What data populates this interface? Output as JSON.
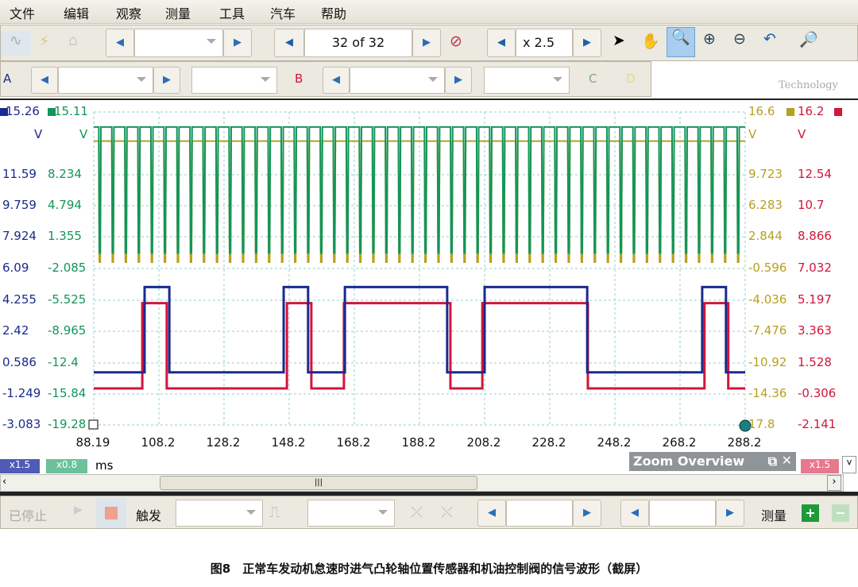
{
  "menu": [
    "文件",
    "编辑",
    "观察",
    "测量",
    "工具",
    "汽车",
    "帮助"
  ],
  "toolbar": {
    "buffer_value": "32 of 32",
    "zoom_value": "x 2.5",
    "watermark": "Technology"
  },
  "channels": {
    "a": "A",
    "b": "B",
    "c": "C",
    "d": "D"
  },
  "colors": {
    "a": "#1b2a8c",
    "b": "#13955a",
    "c": "#b7a020",
    "d": "#d2153a"
  },
  "axes": {
    "a": {
      "top": "15.26",
      "unit": "V",
      "ticks": [
        "11.59",
        "9.759",
        "7.924",
        "6.09",
        "4.255",
        "2.42",
        "0.586",
        "-1.249",
        "-3.083"
      ]
    },
    "b": {
      "top": "15.11",
      "unit": "V",
      "ticks": [
        "8.234",
        "4.794",
        "1.355",
        "-2.085",
        "-5.525",
        "-8.965",
        "-12.4",
        "-15.84",
        "-19.28"
      ]
    },
    "c": {
      "top": "16.6",
      "unit": "V",
      "ticks": [
        "9.723",
        "6.283",
        "2.844",
        "-0.596",
        "-4.036",
        "-7.476",
        "-10.92",
        "-14.36",
        "17.8"
      ]
    },
    "d": {
      "top": "16.2",
      "unit": "V",
      "ticks": [
        "12.54",
        "10.7",
        "8.866",
        "7.032",
        "5.197",
        "3.363",
        "1.528",
        "-0.306",
        "-2.141"
      ]
    },
    "x_ticks": [
      "88.19",
      "108.2",
      "128.2",
      "148.2",
      "168.2",
      "188.2",
      "208.2",
      "228.2",
      "248.2",
      "268.2",
      "288.2"
    ],
    "x_unit": "ms",
    "a_scale": "x1.5",
    "b_scale": "x0.8",
    "d_scale": "x1.5"
  },
  "zoom_overview": {
    "title": "Zoom Overview"
  },
  "bottom": {
    "status": "已停止",
    "trigger": "触发",
    "measure": "测量"
  },
  "caption": "图8　正常车发动机怠速时进气凸轮轴位置传感器和机油控制阀的信号波形（截屏）",
  "chart_data": {
    "type": "line",
    "xlim": [
      88.19,
      288.2
    ],
    "grid": true,
    "series": [
      {
        "channel": "A",
        "low": 0,
        "high": 5,
        "start": "low",
        "edges": [
          103.8,
          111.4,
          146.5,
          154.0,
          165.3,
          196.7,
          208.2,
          239.7,
          275.0,
          282.3
        ],
        "ylim": [
          -3.083,
          15.26
        ]
      },
      {
        "channel": "D",
        "low": 0,
        "high": 5,
        "start": "low",
        "edges": [
          103.1,
          110.6,
          147.5,
          155.0,
          165.0,
          197.7,
          207.5,
          239.9,
          275.7,
          283.0
        ],
        "ylim": [
          -2.141,
          16.2
        ]
      },
      {
        "channel": "B",
        "base": 13.46,
        "pulse": -0.37,
        "period_ms": 4.0,
        "first_pulse": 89.9,
        "ylim": [
          -19.28,
          15.11
        ]
      },
      {
        "channel": "C",
        "base": 13.4,
        "pulse": 0.1,
        "period_ms": 4.0,
        "first_pulse": 89.9,
        "ylim": [
          -17.8,
          16.6
        ]
      }
    ]
  }
}
